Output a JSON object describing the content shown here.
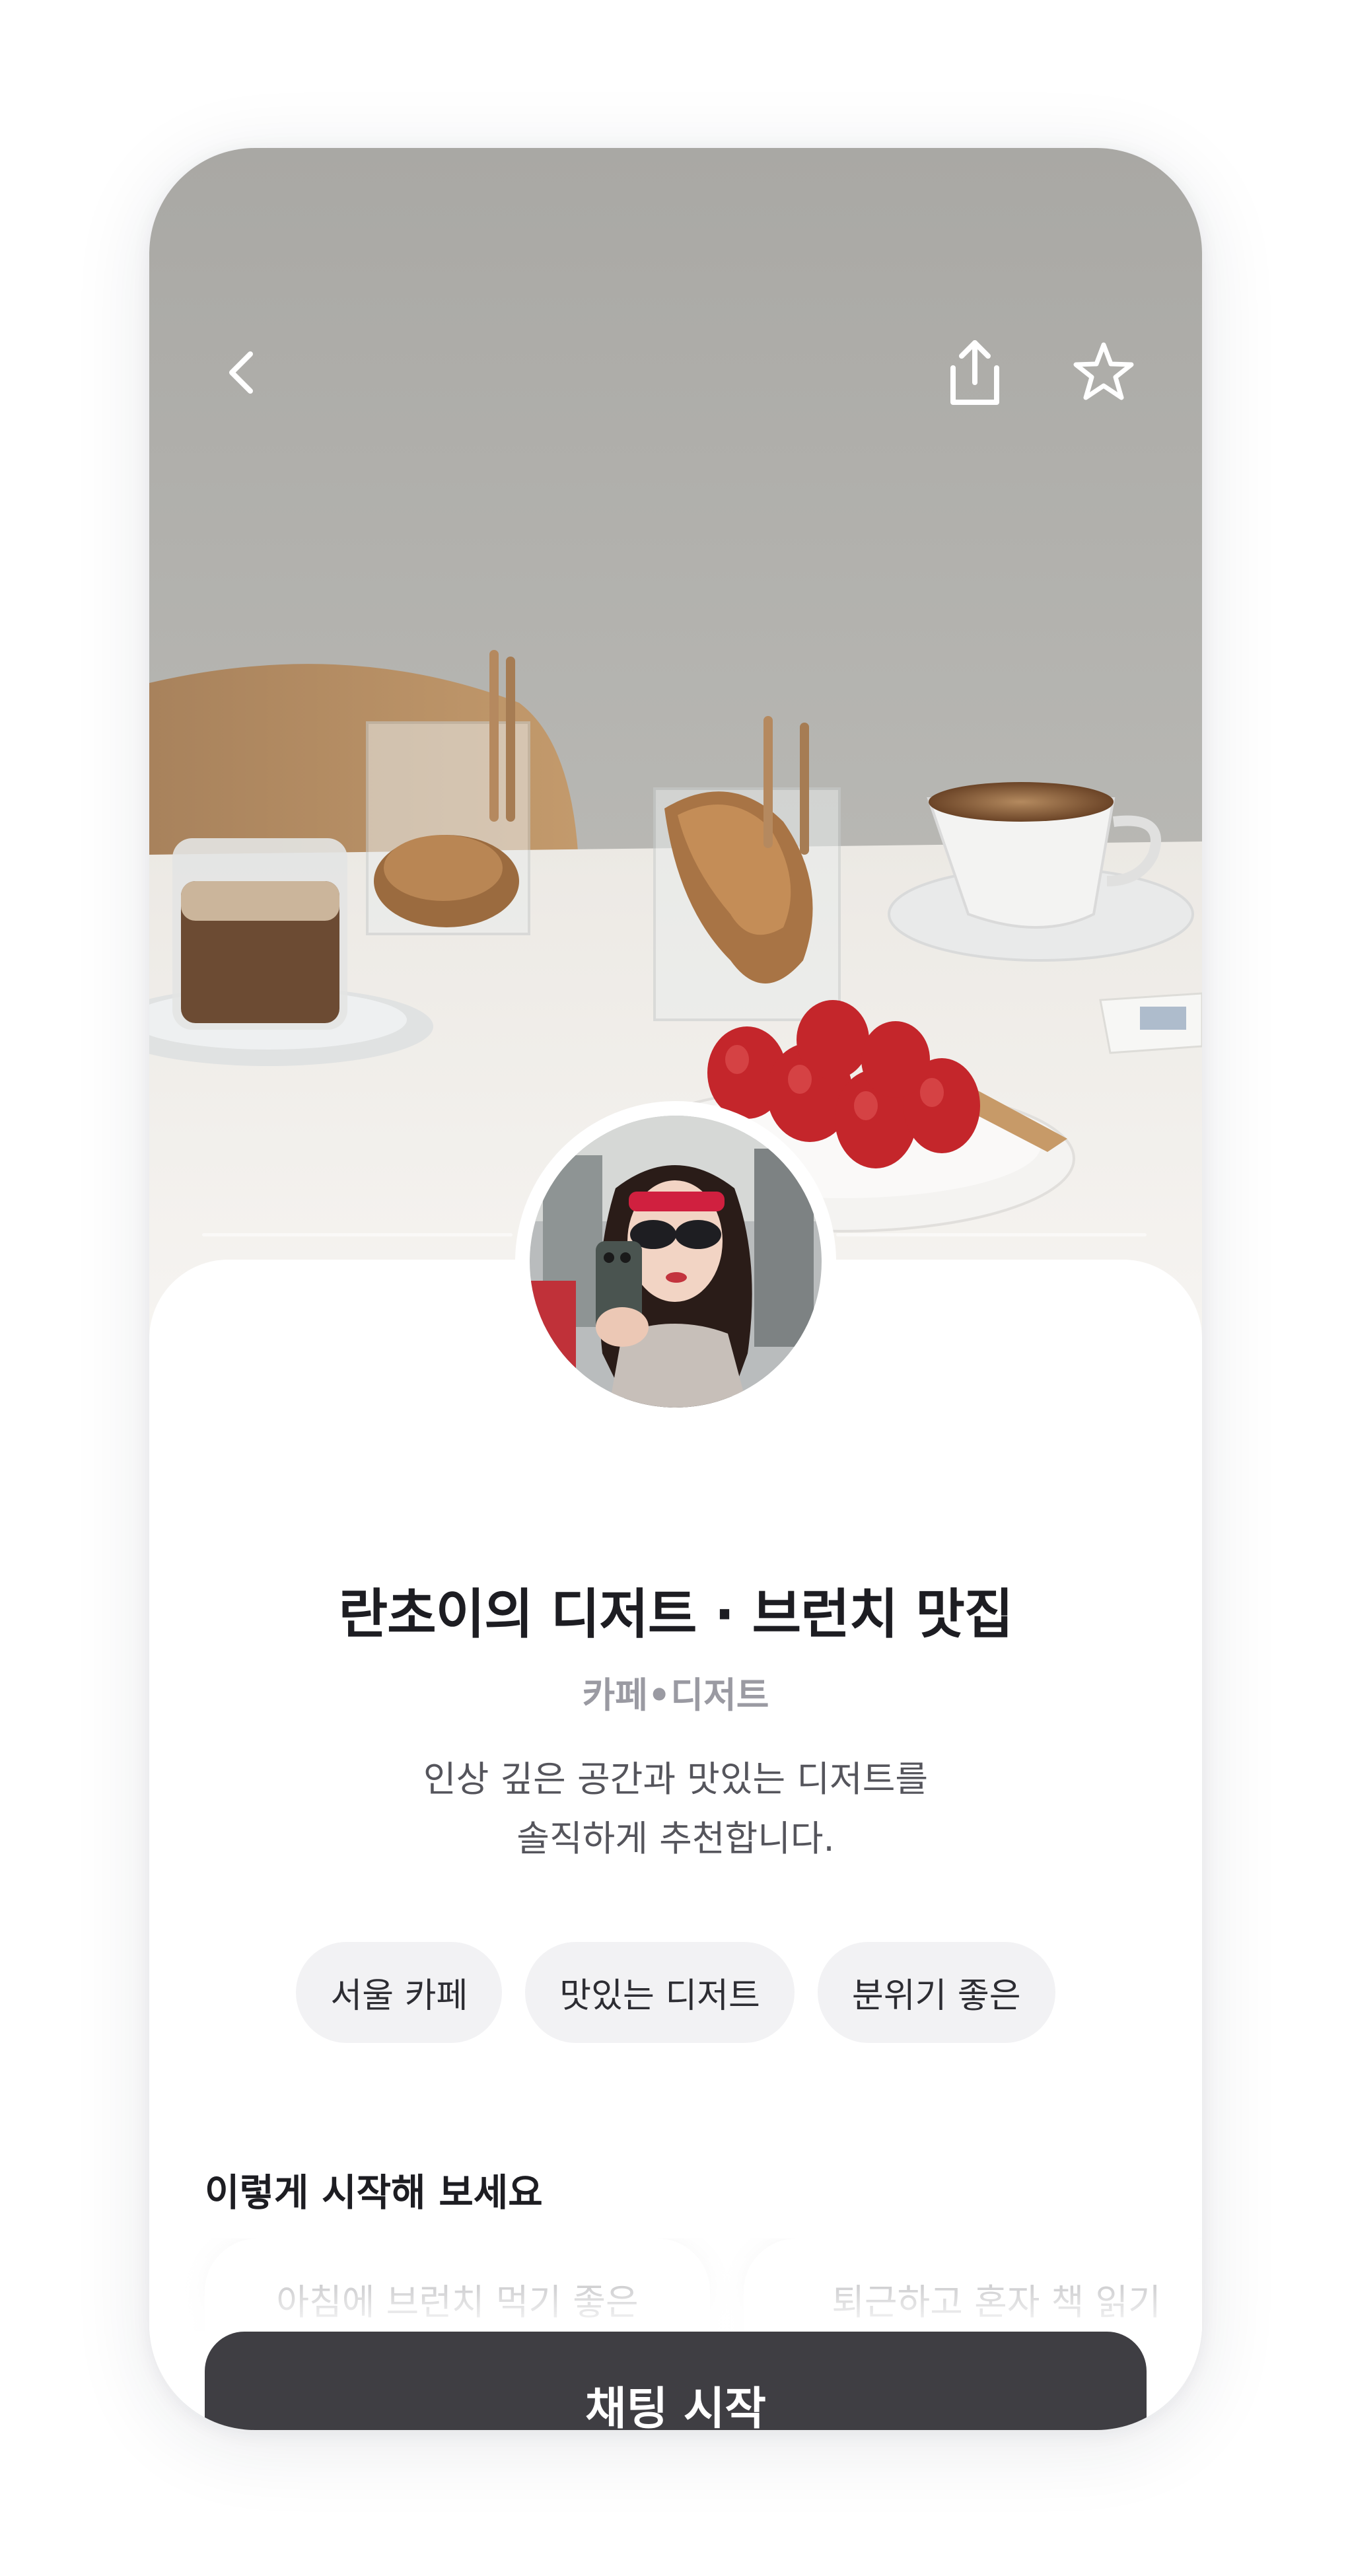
{
  "header": {
    "back_icon": "chevron-left-icon",
    "share_icon": "share-icon",
    "favorite_icon": "star-icon"
  },
  "profile": {
    "title": "란초이의 디저트 · 브런치 맛집",
    "category": "카페•디저트",
    "description_line1": "인상 깊은 공간과 맛있는 디저트를",
    "description_line2": "솔직하게 추천합니다."
  },
  "tags": [
    "서울 카페",
    "맛있는 디저트",
    "분위기 좋은"
  ],
  "starter": {
    "heading": "이렇게 시작해 보세요",
    "suggestions": [
      "아침에 브런치 먹기 좋은",
      "퇴근하고 혼자 책 읽기"
    ]
  },
  "cta": {
    "label": "채팅 시작"
  },
  "colors": {
    "cta_background": "#3f3e43",
    "tag_background": "#f2f2f4",
    "title_text": "#1d1d22",
    "category_text": "#9a9aa2"
  }
}
